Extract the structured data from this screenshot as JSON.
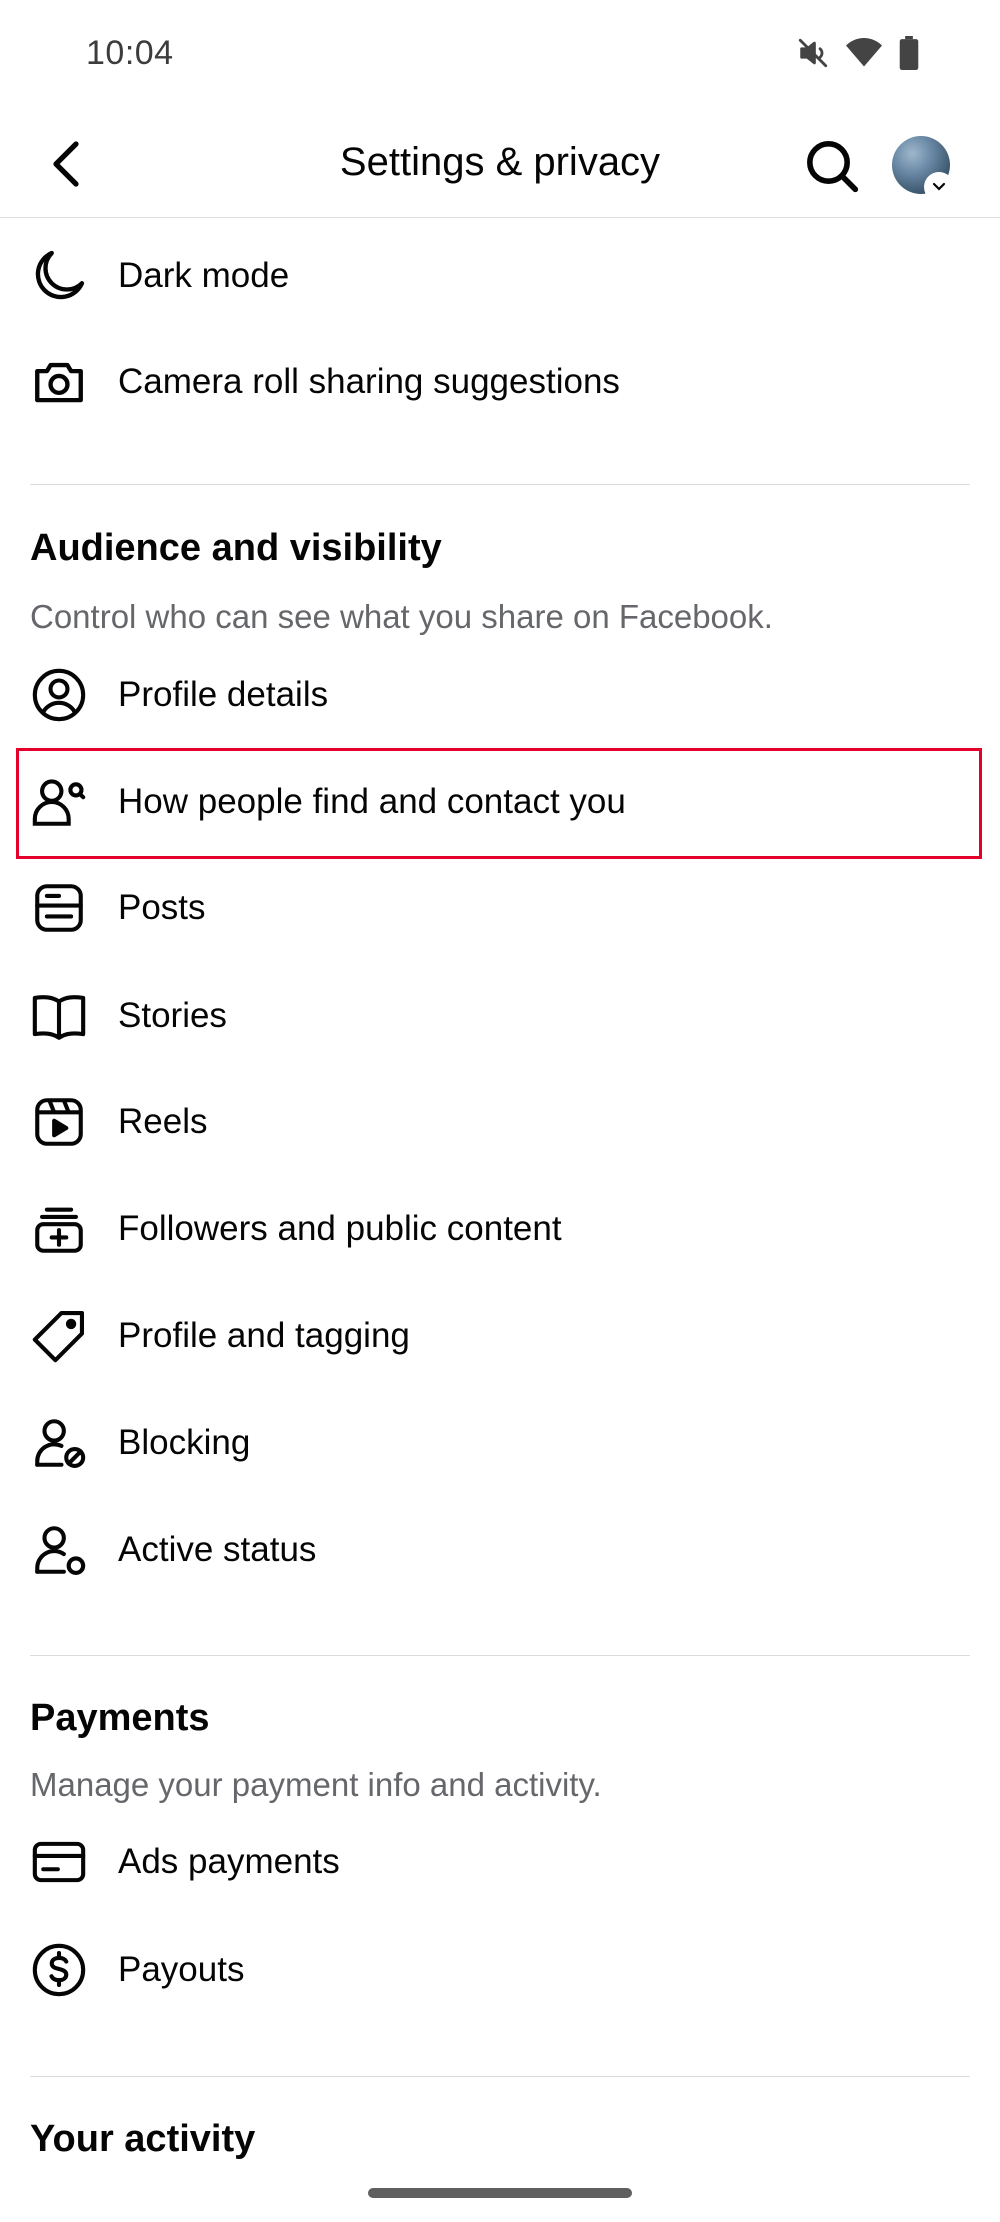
{
  "status_bar": {
    "time": "10:04",
    "icons": [
      "mute-icon",
      "wifi-icon",
      "battery-icon"
    ]
  },
  "header": {
    "title": "Settings & privacy",
    "back_icon": "back-arrow-icon",
    "search_icon": "search-icon"
  },
  "preferences": [
    {
      "label": "Dark mode",
      "icon": "moon-icon"
    },
    {
      "label": "Camera roll sharing suggestions",
      "icon": "camera-icon"
    }
  ],
  "audience": {
    "title": "Audience and visibility",
    "description": "Control who can see what you share on Facebook.",
    "items": [
      {
        "label": "Profile details",
        "icon": "profile-circle-icon"
      },
      {
        "label": "How people find and contact you",
        "icon": "person-search-icon"
      },
      {
        "label": "Posts",
        "icon": "posts-icon"
      },
      {
        "label": "Stories",
        "icon": "book-icon"
      },
      {
        "label": "Reels",
        "icon": "reels-icon"
      },
      {
        "label": "Followers and public content",
        "icon": "followers-icon"
      },
      {
        "label": "Profile and tagging",
        "icon": "tag-icon"
      },
      {
        "label": "Blocking",
        "icon": "block-user-icon"
      },
      {
        "label": "Active status",
        "icon": "active-status-icon"
      }
    ]
  },
  "payments": {
    "title": "Payments",
    "description": "Manage your payment info and activity.",
    "items": [
      {
        "label": "Ads payments",
        "icon": "card-icon"
      },
      {
        "label": "Payouts",
        "icon": "dollar-icon"
      }
    ]
  },
  "activity": {
    "title": "Your activity"
  },
  "colors": {
    "highlight": "#e4002b",
    "text_primary": "#050505",
    "text_secondary": "#65676b",
    "divider": "#dcdcdc"
  }
}
